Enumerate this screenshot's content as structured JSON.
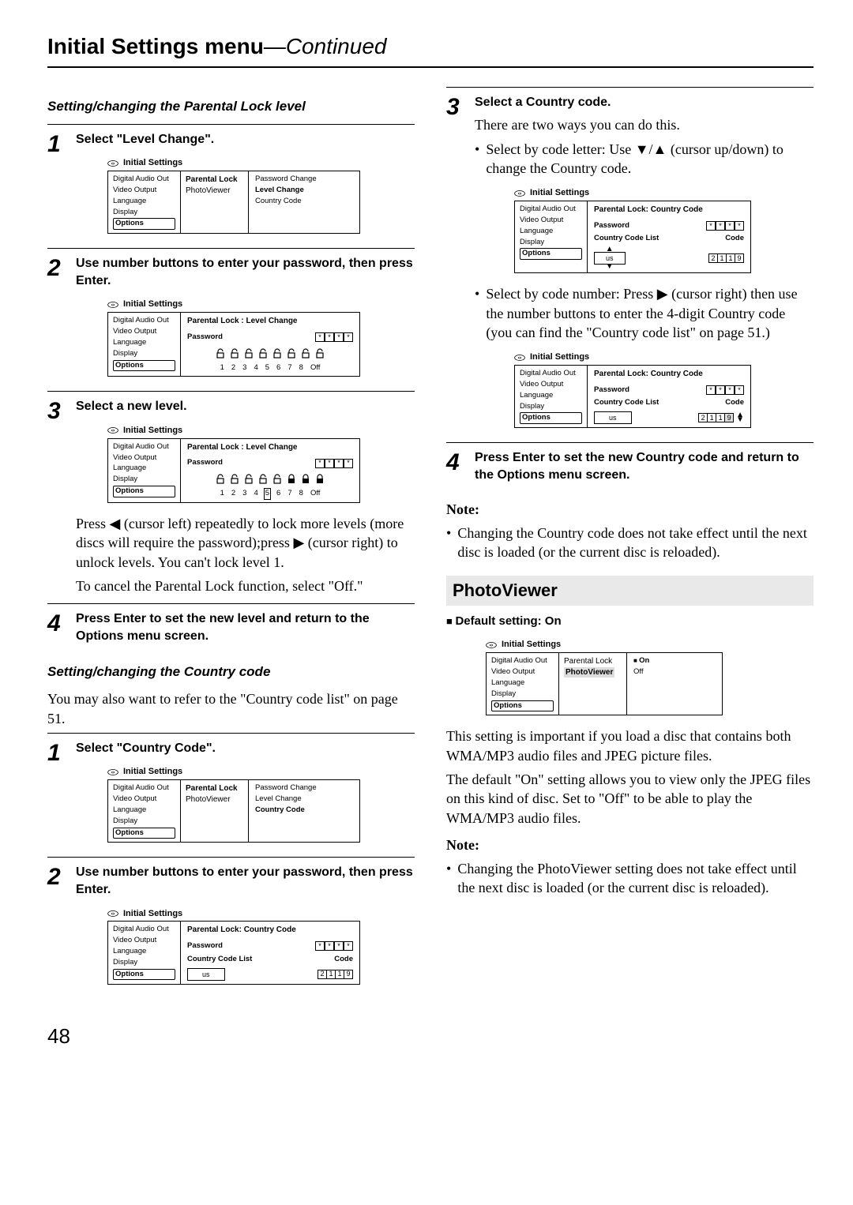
{
  "page_title_main": "Initial Settings menu",
  "page_title_cont": "—Continued",
  "page_number": "48",
  "left": {
    "subhead1": "Setting/changing the Parental Lock level",
    "step1": {
      "num": "1",
      "text": "Select \"Level Change\"."
    },
    "step2": {
      "num": "2",
      "text": "Use number buttons to enter your password, then press Enter."
    },
    "step3": {
      "num": "3",
      "text": "Select a new level."
    },
    "step3_body1": "Press ◀ (cursor left) repeatedly to lock more levels (more discs will require the password);press ▶ (cursor right) to unlock levels. You can't lock level 1.",
    "step3_body2": "To cancel the Parental Lock function, select \"Off.\"",
    "step4": {
      "num": "4",
      "text": "Press Enter to set the new level and return to the Options menu screen."
    },
    "subhead2": "Setting/changing the Country code",
    "cc_intro": "You may also want to refer to the \"Country code list\" on page 51.",
    "ccstep1": {
      "num": "1",
      "text": "Select \"Country Code\"."
    },
    "ccstep2": {
      "num": "2",
      "text": "Use number buttons to enter your password, then press Enter."
    }
  },
  "right": {
    "step3": {
      "num": "3",
      "text": "Select a Country code."
    },
    "step3_line1": "There are two ways you can do this.",
    "step3_bullet1": "Select by code letter: Use ▼/▲ (cursor up/down) to change the Country code.",
    "step3_bullet2": "Select by code number: Press ▶ (cursor right) then use the number buttons to enter the 4-digit Country code (you can find the \"Country code list\" on page 51.)",
    "step4": {
      "num": "4",
      "text": "Press Enter to set the new Country code and return to the Options menu screen."
    },
    "note_label": "Note:",
    "note_bullet": "Changing the Country code does not take effect until the next disc is loaded (or the current disc is reloaded).",
    "pv_heading": "PhotoViewer",
    "pv_default": "Default setting: On",
    "pv_p1": "This setting is important if you load a disc that contains both WMA/MP3 audio files and JPEG picture files.",
    "pv_p2": "The default \"On\" setting allows you to view only the JPEG files on this kind of disc. Set to \"Off\" to be able to play the WMA/MP3 audio files.",
    "pv_note_label": "Note:",
    "pv_note_bullet": "Changing the PhotoViewer setting does not take effect until the next disc is loaded (or the current disc is reloaded)."
  },
  "panels": {
    "title": "Initial Settings",
    "nav": [
      "Digital Audio Out",
      "Video Output",
      "Language",
      "Display",
      "Options"
    ],
    "mid_parental": "Parental Lock",
    "mid_photoviewer": "PhotoViewer",
    "opts_parental": [
      "Password Change",
      "Level Change",
      "Country Code"
    ],
    "bc_level": "Parental Lock : Level Change",
    "bc_cc": "Parental Lock: Country Code",
    "pw_label": "Password",
    "ccl_label": "Country Code List",
    "code_label": "Code",
    "us": "us",
    "code_digits": [
      "2",
      "1",
      "1",
      "9"
    ],
    "level_nums": [
      "1",
      "2",
      "3",
      "4",
      "5",
      "6",
      "7",
      "8",
      "Off"
    ],
    "pv_on": "On",
    "pv_off": "Off"
  }
}
